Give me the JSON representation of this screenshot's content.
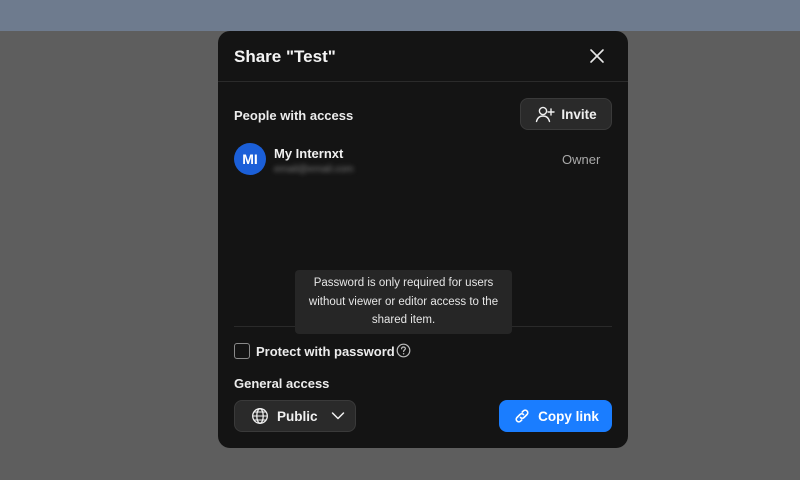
{
  "dialog": {
    "title": "Share \"Test\"",
    "close_icon": "close-icon"
  },
  "people": {
    "section_label": "People with access",
    "invite_label": "Invite",
    "invite_icon": "add-user-icon",
    "users": [
      {
        "initials": "MI",
        "name": "My Internxt",
        "email": "email@email.com",
        "role": "Owner",
        "avatar_color": "#1b5fd8"
      }
    ]
  },
  "tooltip": {
    "text": "Password is only required for users without viewer or editor access to the shared item."
  },
  "password": {
    "label": "Protect with password",
    "checked": false,
    "help_icon": "question-circle-icon"
  },
  "general_access": {
    "label": "General access",
    "selected": "Public",
    "globe_icon": "globe-icon",
    "chevron_icon": "chevron-down-icon"
  },
  "copy_link": {
    "label": "Copy link",
    "icon": "link-icon",
    "color": "#1a7dff"
  }
}
